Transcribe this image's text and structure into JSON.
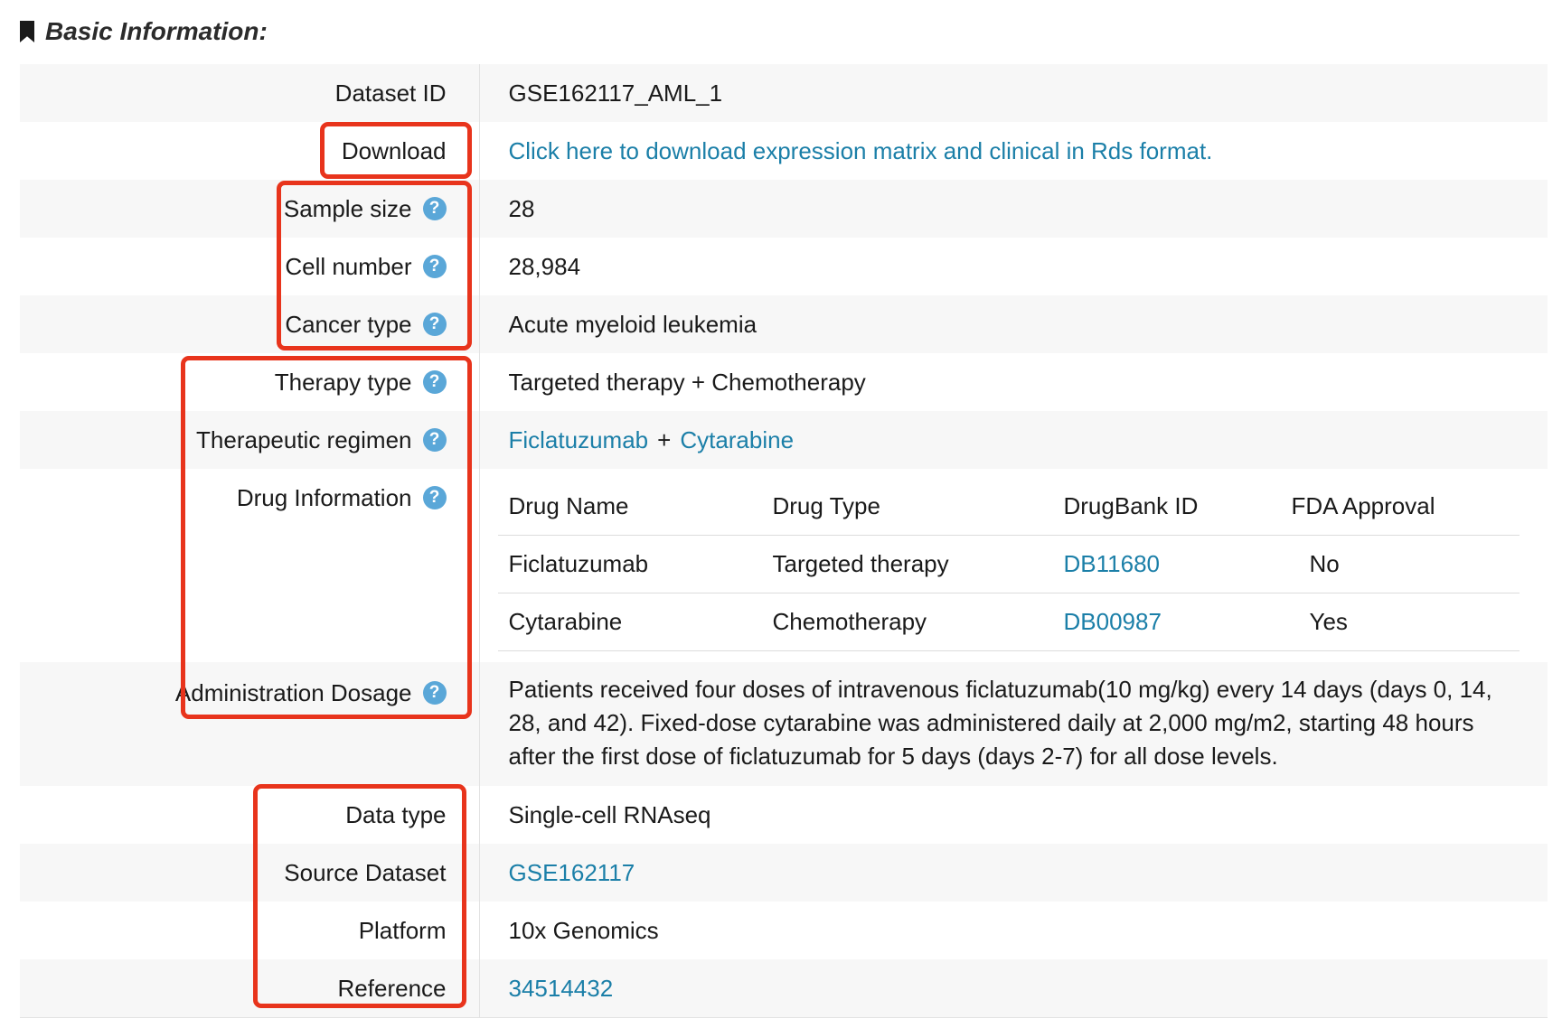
{
  "section_title": "Basic Information:",
  "rows": {
    "dataset_id": {
      "label": "Dataset ID",
      "value": "GSE162117_AML_1"
    },
    "download": {
      "label": "Download",
      "value": "Click here to download expression matrix and clinical in Rds format."
    },
    "sample_size": {
      "label": "Sample size",
      "value": "28"
    },
    "cell_number": {
      "label": "Cell number",
      "value": "28,984"
    },
    "cancer_type": {
      "label": "Cancer type",
      "value": "Acute myeloid leukemia"
    },
    "therapy_type": {
      "label": "Therapy type",
      "value": "Targeted therapy + Chemotherapy"
    },
    "therapeutic_regimen": {
      "label": "Therapeutic regimen",
      "drug1": "Ficlatuzumab",
      "plus": "+",
      "drug2": "Cytarabine"
    },
    "drug_information": {
      "label": "Drug Information"
    },
    "administration_dosage": {
      "label": "Administration Dosage",
      "value": "Patients received four doses of intravenous ficlatuzumab(10 mg/kg) every 14 days (days 0, 14, 28, and 42). Fixed-dose cytarabine was administered daily at 2,000 mg/m2, starting 48 hours after the first dose of ficlatuzumab for 5 days (days 2-7) for all dose levels."
    },
    "data_type": {
      "label": "Data type",
      "value": "Single-cell RNAseq"
    },
    "source_dataset": {
      "label": "Source Dataset",
      "value": "GSE162117"
    },
    "platform": {
      "label": "Platform",
      "value": "10x Genomics"
    },
    "reference": {
      "label": "Reference",
      "value": "34514432"
    }
  },
  "drug_table": {
    "headers": [
      "Drug Name",
      "Drug Type",
      "DrugBank ID",
      "FDA Approval"
    ],
    "rows": [
      {
        "name": "Ficlatuzumab",
        "type": "Targeted therapy",
        "drugbank_id": "DB11680",
        "fda": "No"
      },
      {
        "name": "Cytarabine",
        "type": "Chemotherapy",
        "drugbank_id": "DB00987",
        "fda": "Yes"
      }
    ]
  },
  "help_glyph": "?",
  "colors": {
    "link": "#1b7fa8",
    "help_icon": "#5aa7d8",
    "highlight_box": "#e8341c",
    "row_stripe": "#f7f7f7"
  }
}
